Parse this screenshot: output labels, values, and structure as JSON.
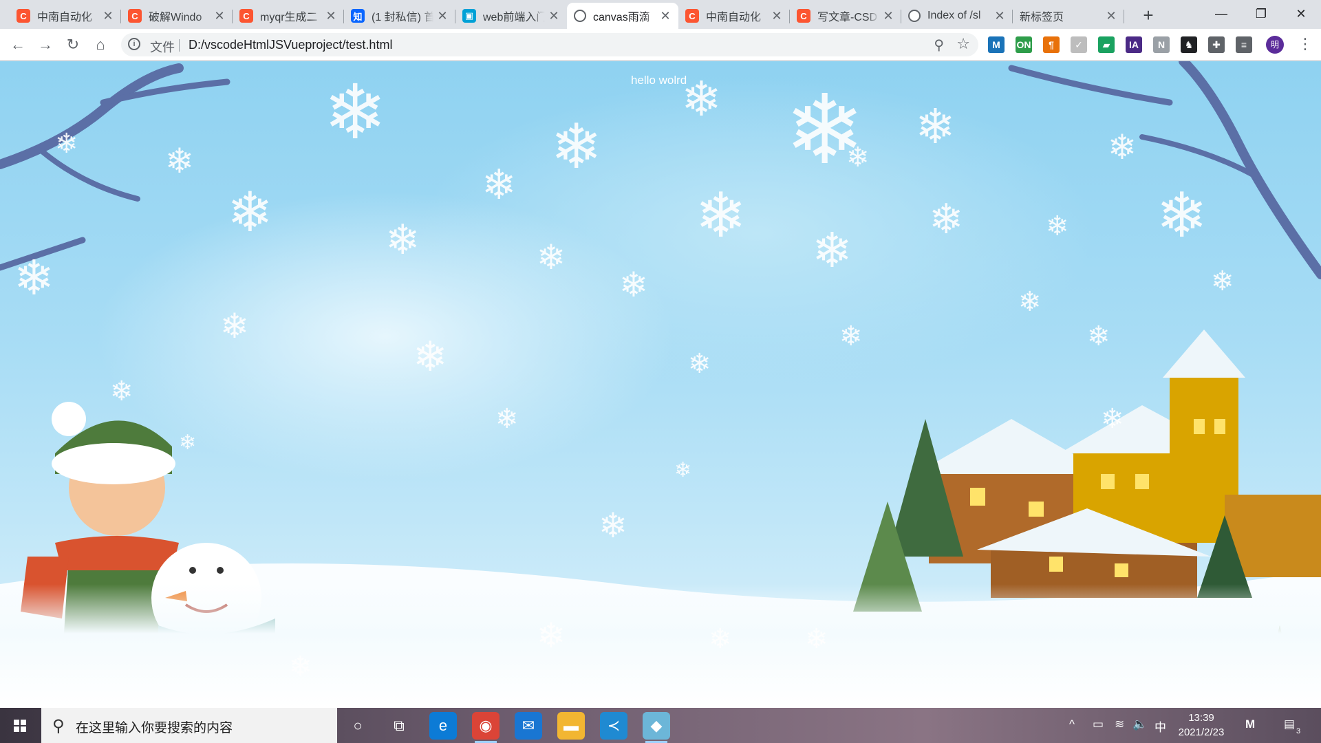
{
  "browser": {
    "tabs": [
      {
        "favicon": "csdn-icon",
        "title": "中南自动化",
        "active": false
      },
      {
        "favicon": "csdn-icon",
        "title": "破解Windo",
        "active": false
      },
      {
        "favicon": "csdn-icon",
        "title": "myqr生成二",
        "active": false
      },
      {
        "favicon": "zhihu-icon",
        "title": "(1 封私信) 首",
        "active": false
      },
      {
        "favicon": "bilibili-icon",
        "title": "web前端入门",
        "active": false
      },
      {
        "favicon": "globe-icon",
        "title": "canvas雨滴",
        "active": true
      },
      {
        "favicon": "csdn-icon",
        "title": "中南自动化",
        "active": false
      },
      {
        "favicon": "csdn-icon",
        "title": "写文章-CSD",
        "active": false
      },
      {
        "favicon": "globe-icon",
        "title": "Index of /sl",
        "active": false
      },
      {
        "favicon": "",
        "title": "新标签页",
        "active": false
      }
    ],
    "close_glyph": "✕",
    "new_tab_glyph": "+",
    "window_controls": {
      "minimize": "—",
      "maximize": "❐",
      "close": "✕"
    },
    "toolbar": {
      "back": "←",
      "forward": "→",
      "reload": "↻",
      "home": "⌂",
      "info_glyph": "i",
      "file_label": "文件",
      "url": "D:/vscodeHtmlJSVueproject/test.html",
      "zoom_glyph": "⚲",
      "bookmark_glyph": "☆",
      "avatar_label": "明",
      "menu_glyph": "⋮"
    },
    "extensions": [
      {
        "name": "m-extension-icon",
        "label": "M",
        "color": "#1a73b8"
      },
      {
        "name": "on-extension-icon",
        "label": "ON",
        "color": "#2e9d4a"
      },
      {
        "name": "pilcrow-extension-icon",
        "label": "¶",
        "color": "#e8710a"
      },
      {
        "name": "check-extension-icon",
        "label": "✓",
        "color": "#bdbdbd"
      },
      {
        "name": "green-extension-icon",
        "label": "▰",
        "color": "#1aa260"
      },
      {
        "name": "ia-extension-icon",
        "label": "IA",
        "color": "#4b2a86"
      },
      {
        "name": "n-extension-icon",
        "label": "N",
        "color": "#9aa0a6"
      },
      {
        "name": "penguin-extension-icon",
        "label": "♞",
        "color": "#202124"
      },
      {
        "name": "puzzle-extension-icon",
        "label": "✚",
        "color": "#5f6368"
      },
      {
        "name": "media-extension-icon",
        "label": "≡",
        "color": "#5f6368"
      }
    ]
  },
  "page": {
    "hello_text": "hello wolrd"
  },
  "taskbar": {
    "search_placeholder": "在这里输入你要搜索的内容",
    "start_glyph": "⊞",
    "search_glyph": "⚲",
    "cortana_glyph": "○",
    "taskview_glyph": "⧉",
    "apps": [
      {
        "name": "edge-icon",
        "glyph": "e",
        "color": "#0c7bd6",
        "running": false
      },
      {
        "name": "chrome-icon",
        "glyph": "◉",
        "color": "#db4437",
        "running": true
      },
      {
        "name": "mail-icon",
        "glyph": "✉",
        "color": "#1976d2",
        "running": false
      },
      {
        "name": "file-explorer-icon",
        "glyph": "▬",
        "color": "#f2b632",
        "running": false
      },
      {
        "name": "vscode-icon",
        "glyph": "≺",
        "color": "#1f8ad2",
        "running": false
      },
      {
        "name": "app-icon",
        "glyph": "◆",
        "color": "#6cb6d8",
        "running": true
      }
    ],
    "tray": {
      "chevron": "^",
      "battery": "▭",
      "wifi": "≋",
      "volume": "🔈",
      "ime": "中",
      "time": "13:39",
      "date": "2021/2/23",
      "notification_count": "3"
    }
  },
  "colors": {
    "sky": "#8fd2f1",
    "snow": "#ffffff",
    "tab_active": "#ffffff",
    "tab_strip": "#dee1e6"
  }
}
